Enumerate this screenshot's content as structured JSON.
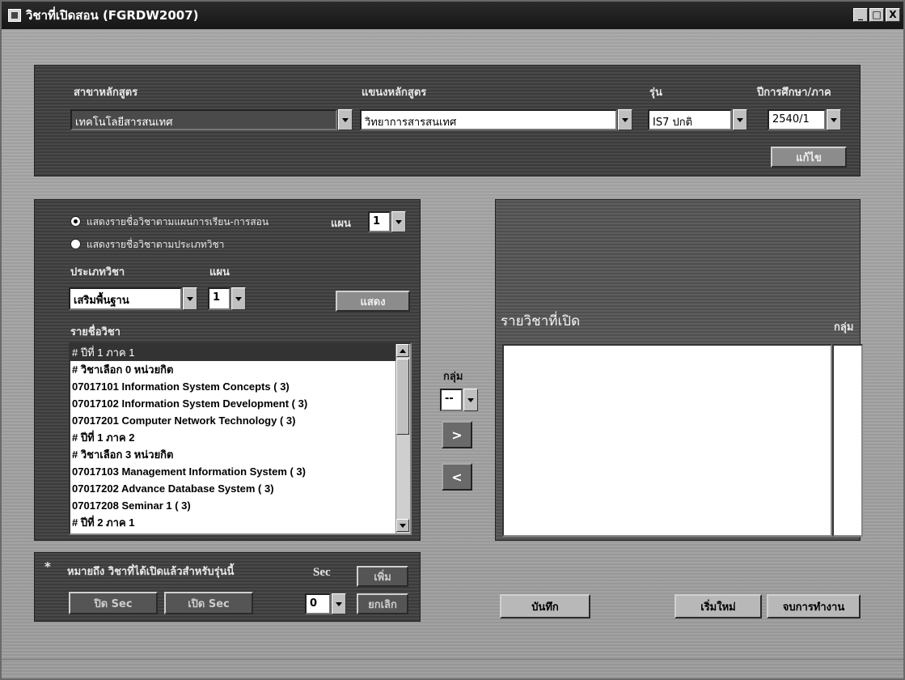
{
  "window": {
    "title": "วิชาที่เปิดสอน (FGRDW2007)",
    "minimize": "_",
    "maximize": "□",
    "close": "X"
  },
  "top_panel": {
    "curriculum_label": "สาขาหลักสูตร",
    "curriculum_value": "เทคโนโลยีสารสนเทศ",
    "plan_label": "แขนงหลักสูตร",
    "plan_value": "วิทยาการสารสนเทศ",
    "generation_label": "รุ่น",
    "generation_value": "IS7 ปกติ",
    "year_term_label": "ปีการศึกษา/ภาค",
    "year_term_value": "2540/1",
    "refresh_button": "แก้ไข"
  },
  "left_panel": {
    "radio_by_plan_label": "แสดงรายชื่อวิชาตามแผนการเรียน-การสอน",
    "plan_small_label": "แผน",
    "plan_small_value": "1",
    "radio_by_type_label": "แสดงรายชื่อวิชาตามประเภทวิชา",
    "type_label": "ประเภทวิชา",
    "plan2_label": "แผน",
    "type_value": "เสริมพื้นฐาน",
    "plan2_value": "1",
    "show_button": "แสดง",
    "list_label": "รายชื่อวิชา",
    "courses": [
      "# ปีที่ 1 ภาค 1",
      "# วิชาเลือก 0 หน่วยกิต",
      "07017101  Information System Concepts ( 3)",
      "07017102  Information System Development ( 3)",
      "07017201  Computer Network Technology ( 3)",
      "# ปีที่ 1 ภาค 2",
      "# วิชาเลือก 3 หน่วยกิต",
      "07017103  Management Information System ( 3)",
      "07017202  Advance Database System ( 3)",
      "07017208  Seminar 1 ( 3)",
      "# ปีที่ 2 ภาค 1"
    ]
  },
  "middle": {
    "group_label": "กลุ่ม",
    "group_value": "--",
    "add_arrow": ">",
    "remove_arrow": "<"
  },
  "right_panel": {
    "opened_label": "รายวิชาที่เปิด",
    "group_label": "กลุ่ม"
  },
  "bottom_panel": {
    "asterisk": "*",
    "note": "หมายถึง  วิชาที่ได้เปิดแล้วสำหรับรุ่นนี้",
    "sec_label": "Sec",
    "sec_value": "0",
    "add_button": "เพิ่ม",
    "cancel_button": "ยกเลิก",
    "close_sec_button": "ปิด Sec",
    "open_sec_button": "เปิด Sec"
  },
  "actions": {
    "save_button": "บันทึก",
    "restart_button": "เริ่มใหม่",
    "exit_button": "จบการทำงาน"
  }
}
